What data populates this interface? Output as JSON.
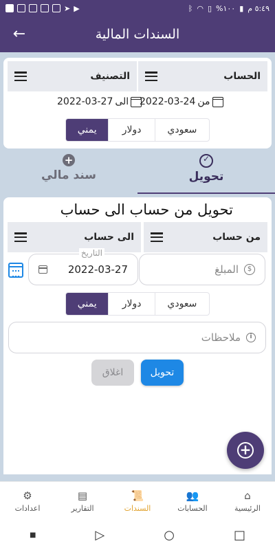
{
  "status_bar": {
    "time": "٥:٤٩ م",
    "battery": "%١٠٠"
  },
  "app_bar": {
    "title": "السندات المالية",
    "back_icon": "arrow-back-icon"
  },
  "filter_card": {
    "account_label": "الحساب",
    "category_label": "التصنيف",
    "from_label": "من",
    "from_date": "2022-03-24",
    "to_label": "الى",
    "to_date": "2022-03-27",
    "currencies": [
      "سعودي",
      "دولار",
      "يمني"
    ],
    "selected_currency": "يمني"
  },
  "tabs": [
    {
      "label": "تحويل",
      "icon": "sync-icon",
      "active": true
    },
    {
      "label": "سند مالي",
      "icon": "plus-circle-icon",
      "active": false
    }
  ],
  "transfer_form": {
    "title": "تحويل من حساب الى حساب",
    "from_account_label": "من حساب",
    "to_account_label": "الى حساب",
    "amount_placeholder": "المبلغ",
    "date_label": "التاريخ",
    "date_value": "2022-03-27",
    "currencies": [
      "سعودي",
      "دولار",
      "يمني"
    ],
    "selected_currency": "يمني",
    "notes_placeholder": "ملاحظات",
    "submit_label": "تحويل",
    "close_label": "اغلاق"
  },
  "bottom_nav": [
    {
      "label": "الرئيسية",
      "icon": "home-icon",
      "active": false
    },
    {
      "label": "الحسابات",
      "icon": "people-icon",
      "active": false
    },
    {
      "label": "السندات",
      "icon": "document-icon",
      "active": true
    },
    {
      "label": "التقارير",
      "icon": "report-icon",
      "active": false
    },
    {
      "label": "اعدادات",
      "icon": "settings-icon",
      "active": false
    }
  ],
  "colors": {
    "primary": "#4e3d76",
    "accent": "#1e88e5",
    "active_nav": "#e0a02a",
    "background": "#c9d6e3"
  }
}
